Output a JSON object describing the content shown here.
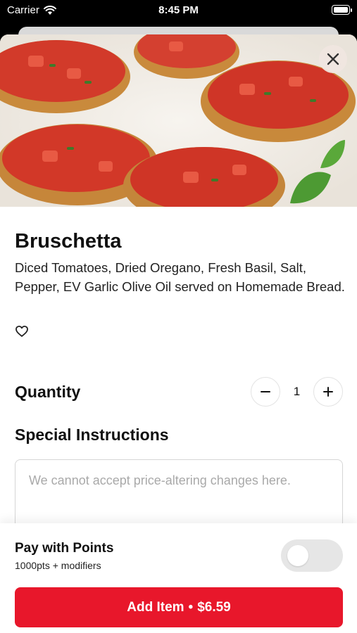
{
  "status_bar": {
    "carrier": "Carrier",
    "time": "8:45 PM"
  },
  "item": {
    "title": "Bruschetta",
    "description": "Diced Tomatoes, Dried Oregano, Fresh Basil, Salt, Pepper, EV Garlic Olive Oil served on Homemade Bread.",
    "image": "bruschetta-photo"
  },
  "quantity": {
    "label": "Quantity",
    "value": "1"
  },
  "special_instructions": {
    "label": "Special Instructions",
    "placeholder": "We cannot accept price-altering changes here."
  },
  "points": {
    "title": "Pay with Points",
    "subtitle": "1000pts + modifiers",
    "enabled": false
  },
  "add_button": {
    "label": "Add Item",
    "separator": "•",
    "price": "$6.59"
  },
  "icons": [
    "wifi-icon",
    "battery-icon",
    "close-icon",
    "heart-icon",
    "minus-icon",
    "plus-icon"
  ],
  "colors": {
    "accent": "#e8172b",
    "toggle_off": "#e6e6e6"
  }
}
